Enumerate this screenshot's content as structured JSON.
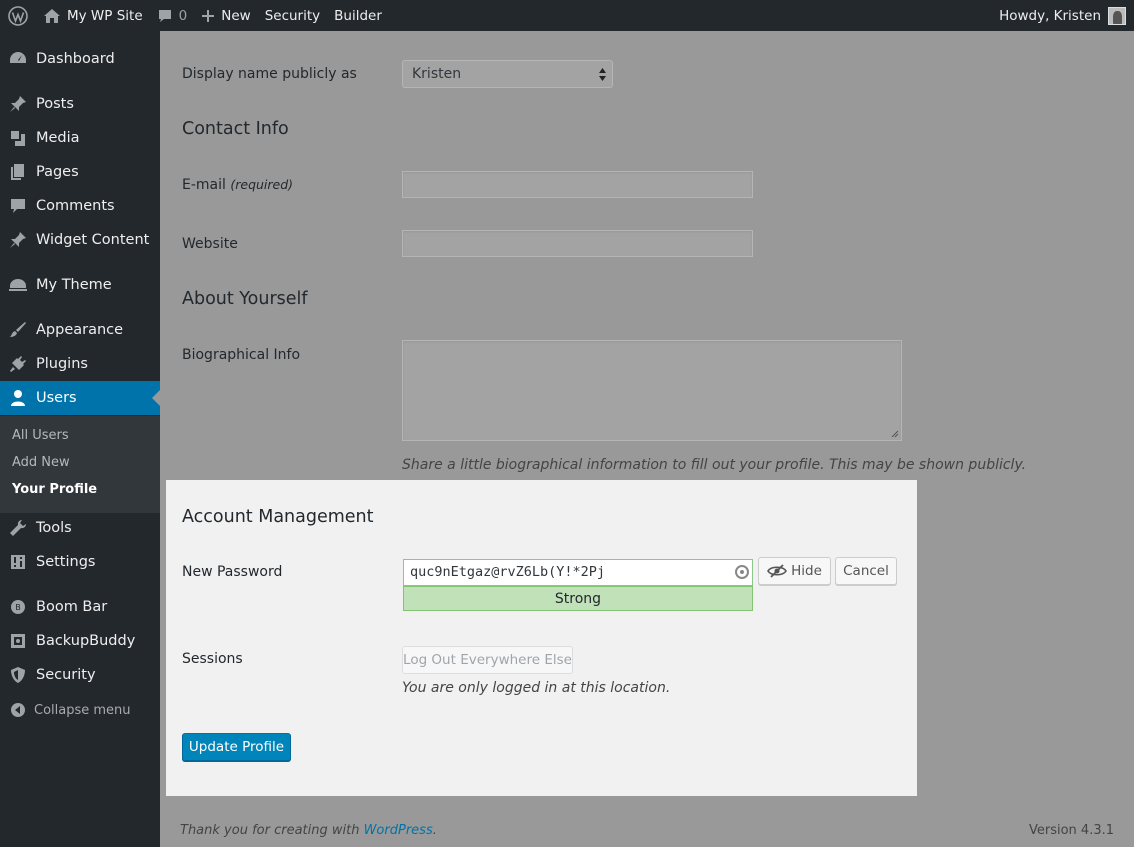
{
  "adminbar": {
    "site_name": "My WP Site",
    "comments_count": "0",
    "new_label": "New",
    "security_label": "Security",
    "builder_label": "Builder",
    "howdy": "Howdy, Kristen"
  },
  "sidebar": {
    "items": [
      {
        "label": "Dashboard",
        "icon": "dashboard-icon"
      },
      {
        "label": "Posts",
        "icon": "pin-icon"
      },
      {
        "label": "Media",
        "icon": "media-icon"
      },
      {
        "label": "Pages",
        "icon": "pages-icon"
      },
      {
        "label": "Comments",
        "icon": "comment-icon"
      },
      {
        "label": "Widget Content",
        "icon": "pin-icon"
      },
      {
        "label": "My Theme",
        "icon": "helmet-icon"
      },
      {
        "label": "Appearance",
        "icon": "brush-icon"
      },
      {
        "label": "Plugins",
        "icon": "plug-icon"
      },
      {
        "label": "Users",
        "icon": "user-icon"
      },
      {
        "label": "Tools",
        "icon": "wrench-icon"
      },
      {
        "label": "Settings",
        "icon": "sliders-icon"
      },
      {
        "label": "Boom Bar",
        "icon": "boom-icon"
      },
      {
        "label": "BackupBuddy",
        "icon": "backup-icon"
      },
      {
        "label": "Security",
        "icon": "shield-icon"
      }
    ],
    "submenu": [
      "All Users",
      "Add New",
      "Your Profile"
    ],
    "collapse_label": "Collapse menu"
  },
  "form": {
    "display_name_label": "Display name publicly as",
    "display_name_value": "Kristen",
    "contact_title": "Contact Info",
    "email_label": "E-mail",
    "email_required": "(required)",
    "website_label": "Website",
    "about_title": "About Yourself",
    "bio_label": "Biographical Info",
    "bio_desc": "Share a little biographical information to fill out your profile. This may be shown publicly."
  },
  "account": {
    "title": "Account Management",
    "new_password_label": "New Password",
    "password_value": "quc9nEtgaz@rvZ6Lb(Y!*2Pj",
    "strength": "Strong",
    "hide_label": "Hide",
    "cancel_label": "Cancel",
    "sessions_label": "Sessions",
    "logout_label": "Log Out Everywhere Else",
    "sessions_desc": "You are only logged in at this location.",
    "update_label": "Update Profile"
  },
  "footer": {
    "thanks_prefix": "Thank you for creating with ",
    "wordpress_link": "WordPress",
    "thanks_suffix": ".",
    "version": "Version 4.3.1"
  }
}
